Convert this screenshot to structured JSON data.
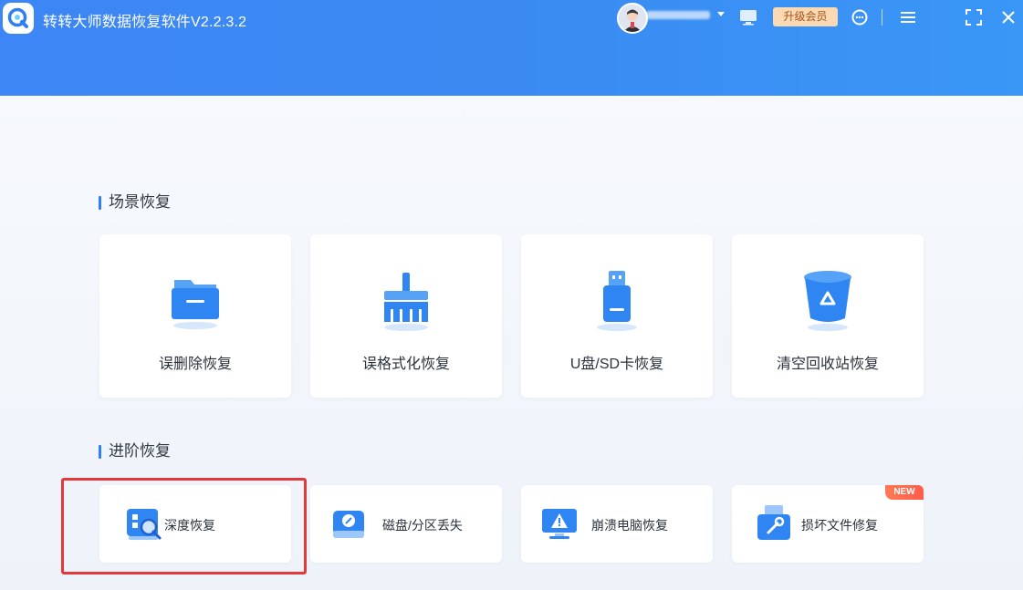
{
  "app": {
    "title": "转转大师数据恢复软件V2.2.3.2",
    "logo_icon": "search-q-logo"
  },
  "header": {
    "upgrade_label": "升级会员",
    "icons": [
      "avatar",
      "chevron-down-icon",
      "monitor-icon",
      "customer-service-icon",
      "menu-icon",
      "fullscreen-icon",
      "close-icon"
    ]
  },
  "scene_section": {
    "title": "场景恢复",
    "cards": [
      {
        "label": "误删除恢复",
        "icon": "folder-icon"
      },
      {
        "label": "误格式化恢复",
        "icon": "broom-icon"
      },
      {
        "label": "U盘/SD卡恢复",
        "icon": "usb-drive-icon"
      },
      {
        "label": "清空回收站恢复",
        "icon": "recycle-bin-icon"
      }
    ]
  },
  "advanced_section": {
    "title": "进阶恢复",
    "cards": [
      {
        "label": "深度恢复",
        "icon": "deep-scan-icon"
      },
      {
        "label": "磁盘/分区丢失",
        "icon": "disk-icon"
      },
      {
        "label": "崩溃电脑恢复",
        "icon": "crashed-monitor-icon"
      },
      {
        "label": "损坏文件修复",
        "icon": "repair-toolbox-icon",
        "badge": "NEW"
      }
    ]
  },
  "colors": {
    "header_start": "#3d86f5",
    "header_end": "#3a97f6",
    "accent": "#2f7ef5",
    "highlight": "#e2393a",
    "upgrade_bg": "#fbd9b2"
  }
}
